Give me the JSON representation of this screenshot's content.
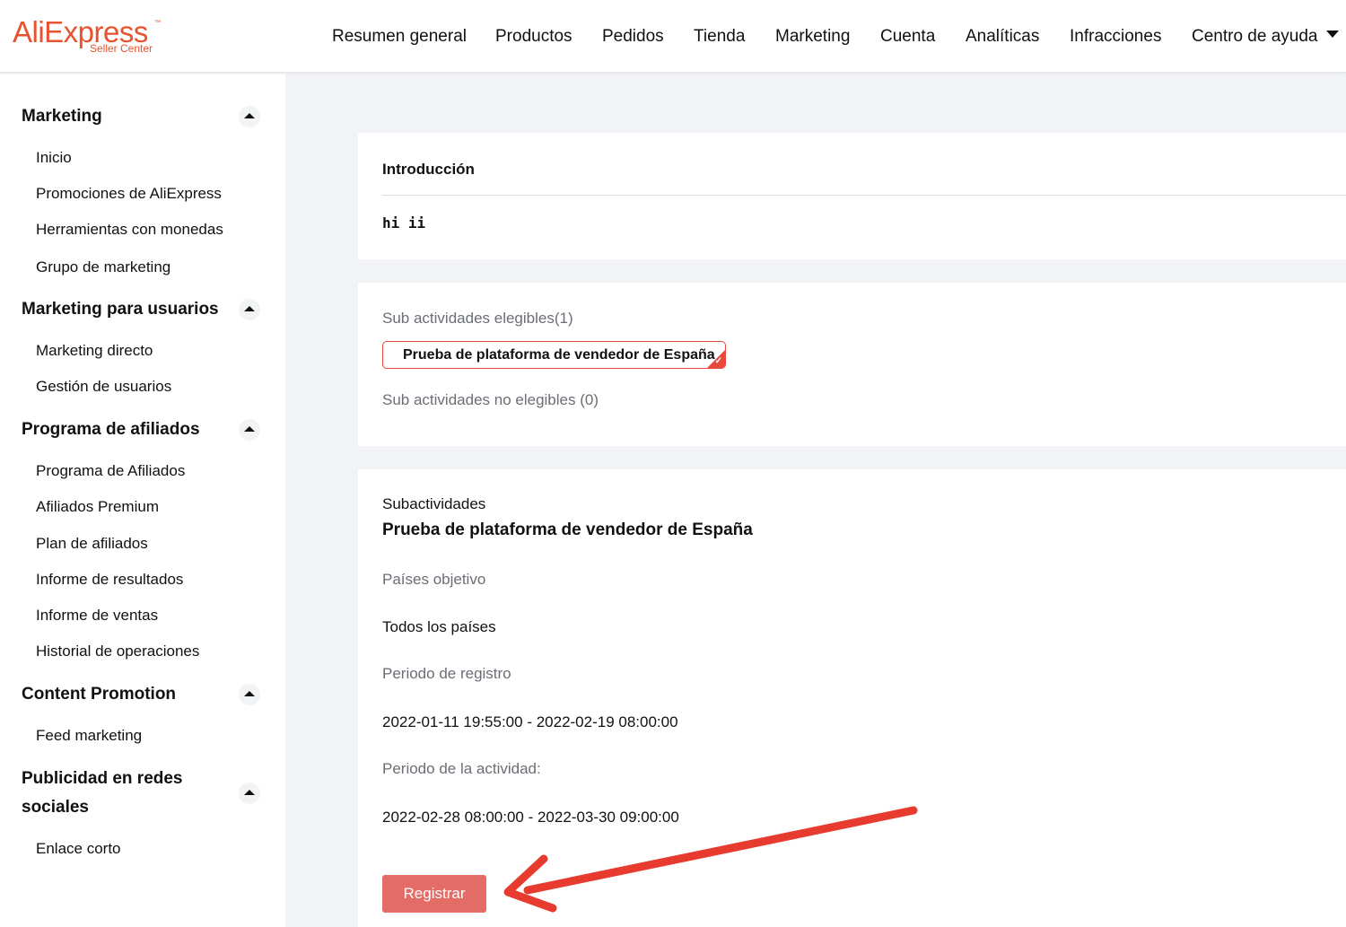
{
  "header": {
    "logo_main": "AliExpress",
    "logo_sub": "Seller Center",
    "logo_tm": "™",
    "nav": [
      "Resumen general",
      "Productos",
      "Pedidos",
      "Tienda",
      "Marketing",
      "Cuenta",
      "Analíticas",
      "Infracciones",
      "Centro de ayuda"
    ]
  },
  "sidebar": {
    "sections": [
      {
        "title": "Marketing",
        "items": [
          "Inicio",
          "Promociones de AliExpress",
          "Herramientas con monedas",
          "Grupo de marketing"
        ]
      },
      {
        "title": "Marketing para usuarios",
        "items": [
          "Marketing directo",
          "Gestión de usuarios"
        ]
      },
      {
        "title": "Programa de afiliados",
        "items": [
          "Programa de Afiliados",
          "Afiliados Premium",
          "Plan de afiliados",
          "Informe de resultados",
          "Informe de ventas",
          "Historial de operaciones"
        ]
      },
      {
        "title": "Content Promotion",
        "items": [
          "Feed marketing"
        ]
      },
      {
        "title_line1": "Publicidad en redes",
        "title_line2": "sociales",
        "items": [
          "Enlace corto"
        ]
      }
    ]
  },
  "intro": {
    "title": "Introducción",
    "text": "hi ii"
  },
  "eligibility": {
    "eligible_label": "Sub actividades elegibles(1)",
    "selected_chip": "Prueba de plataforma de vendedor de España",
    "not_eligible_label": "Sub actividades no elegibles (0)"
  },
  "subactivity": {
    "label": "Subactividades",
    "name": "Prueba de plataforma de vendedor de España",
    "countries_label": "Países objetivo",
    "countries_value": "Todos los países",
    "registration_label": "Periodo de registro",
    "registration_value": "2022-01-11 19:55:00 - 2022-02-19 08:00:00",
    "activity_label": "Periodo de la actividad:",
    "activity_value": "2022-02-28 08:00:00 - 2022-03-30 09:00:00",
    "register_button": "Registrar"
  },
  "colors": {
    "brand": "#e8522e",
    "button": "#e36c66",
    "chip_border": "#e8493e",
    "annotation_arrow": "#e63b2e"
  }
}
